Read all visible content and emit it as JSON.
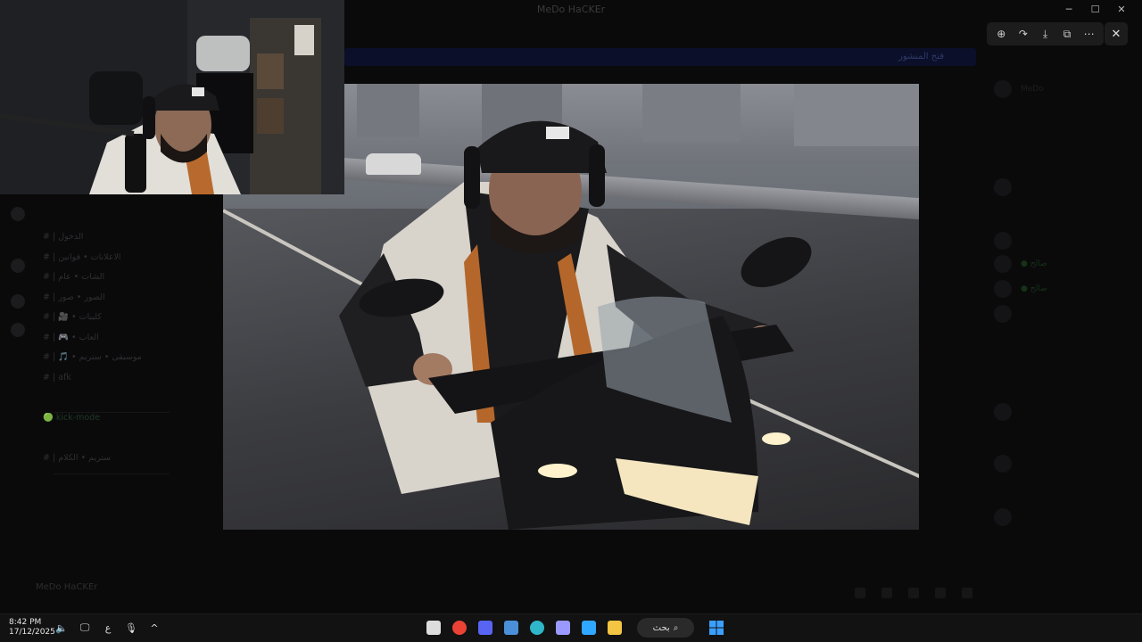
{
  "background_app": {
    "title": "MeDo HaCKEr",
    "banner_text": "فتح المنشور",
    "user_name": "MeDo HaCKEr",
    "channels": [
      {
        "label": "# | الدخول",
        "green": false
      },
      {
        "label": "# | الاعلانات • قوانين",
        "green": false
      },
      {
        "label": "# | الشات • عام",
        "green": false
      },
      {
        "label": "# | الصور • صور",
        "green": false
      },
      {
        "label": "# | 🎥 • كليبات",
        "green": false
      },
      {
        "label": "# | 🎮 • العاب",
        "green": false
      },
      {
        "label": "# | 🎵 • موسيقى • ستريم",
        "green": false
      },
      {
        "label": "# | afk",
        "green": false
      },
      {
        "label": "",
        "green": false
      },
      {
        "label": "🟢 kick-mode",
        "green": true
      },
      {
        "label": "",
        "green": false
      },
      {
        "label": "# | ستريم • الكلام",
        "green": false
      }
    ],
    "members": [
      {
        "name": "MeDo",
        "green": false
      },
      {
        "name": "",
        "green": false
      },
      {
        "name": "",
        "green": false
      },
      {
        "name": "● صالح",
        "green": true
      },
      {
        "name": "● صالح",
        "green": true
      },
      {
        "name": "",
        "green": false
      },
      {
        "name": "",
        "green": false
      },
      {
        "name": "",
        "green": false
      },
      {
        "name": "",
        "green": false
      }
    ]
  },
  "viewer": {
    "toolbar": [
      {
        "name": "zoom-icon",
        "glyph": "⊕"
      },
      {
        "name": "share-icon",
        "glyph": "↷"
      },
      {
        "name": "download-icon",
        "glyph": "⤓"
      },
      {
        "name": "open-external-icon",
        "glyph": "⧉"
      },
      {
        "name": "more-icon",
        "glyph": "⋯"
      }
    ],
    "close_glyph": "✕"
  },
  "taskbar": {
    "time": "8:42 PM",
    "date": "17/12/2025",
    "tray": [
      {
        "name": "volume-icon",
        "glyph": "🔈"
      },
      {
        "name": "network-icon",
        "glyph": "🖵"
      },
      {
        "name": "language-indicator",
        "glyph": "ع"
      },
      {
        "name": "microphone-icon",
        "glyph": "🎙"
      },
      {
        "name": "chevron-up-icon",
        "glyph": "^"
      }
    ],
    "search_label": "بحث",
    "apps": [
      {
        "name": "obs-icon",
        "color": "#dddddd"
      },
      {
        "name": "chrome-icon",
        "color": "#ea4335"
      },
      {
        "name": "discord-icon",
        "color": "#5865f2"
      },
      {
        "name": "file-explorer-icon",
        "color": "#4a8fd8"
      },
      {
        "name": "edge-icon",
        "color": "#2fb7c9"
      },
      {
        "name": "premiere-icon",
        "color": "#9999ff"
      },
      {
        "name": "photoshop-icon",
        "color": "#31a8ff"
      },
      {
        "name": "folder-icon",
        "color": "#f4c542"
      }
    ],
    "colors": {
      "start": "#3aa0ff",
      "bar": "#121212"
    }
  }
}
